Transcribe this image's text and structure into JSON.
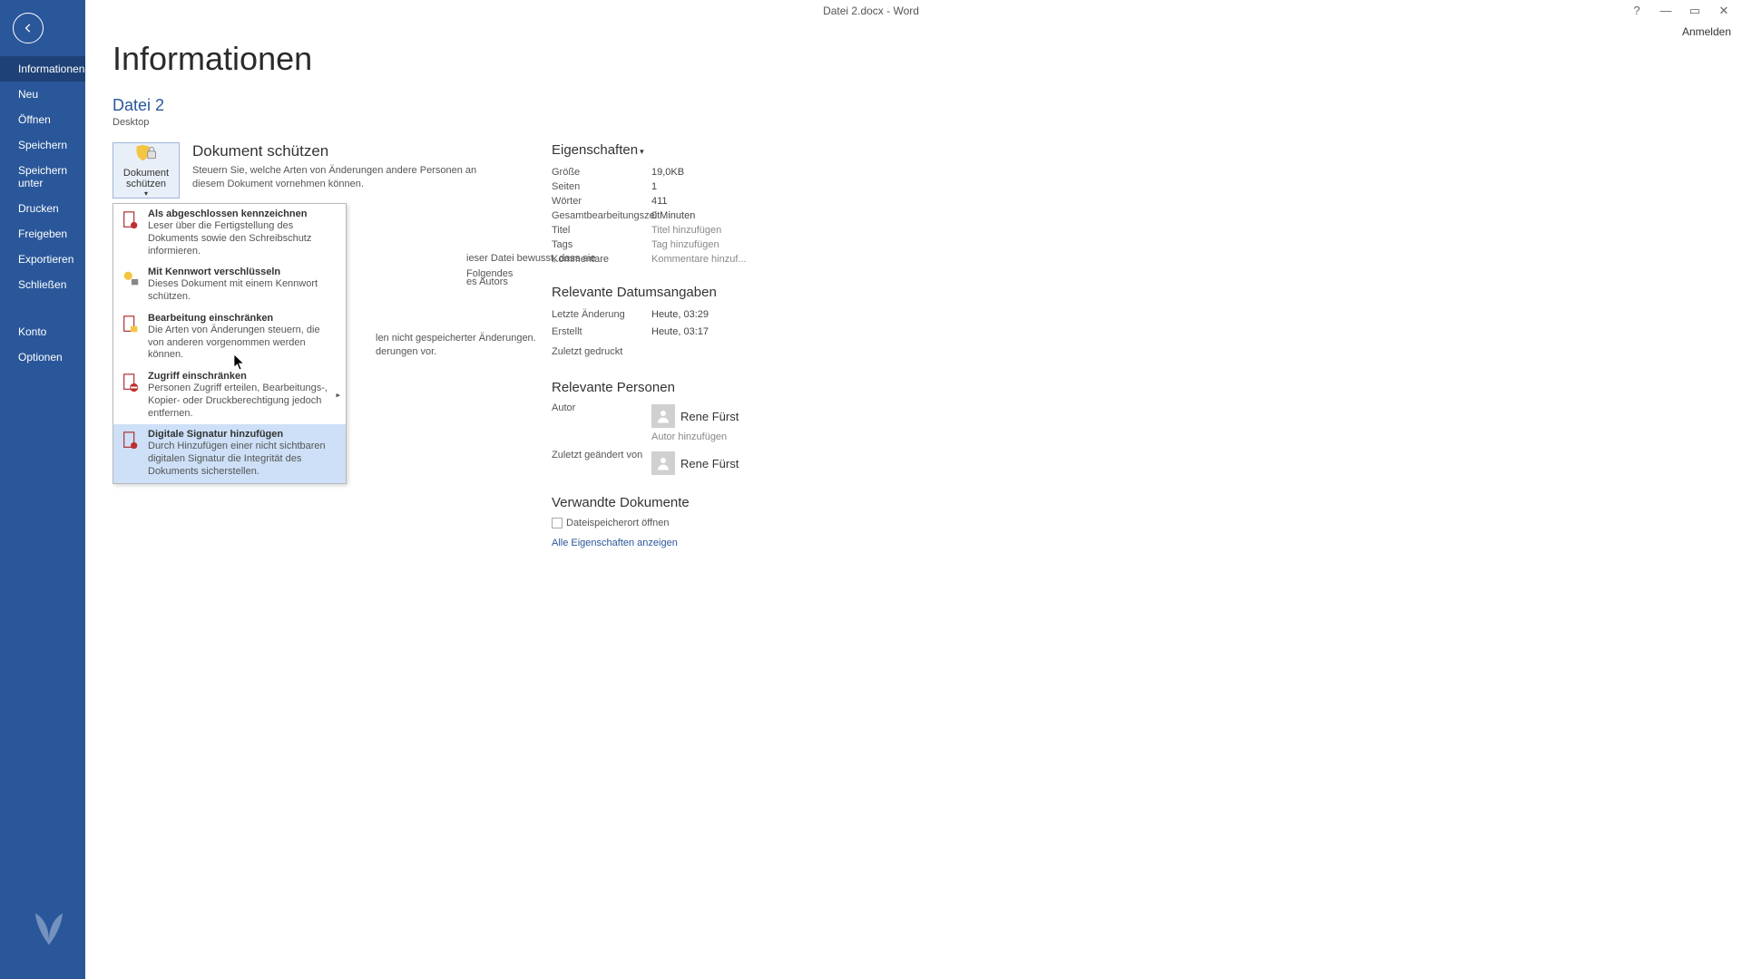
{
  "titlebar": {
    "title": "Datei 2.docx - Word",
    "signin": "Anmelden"
  },
  "sidebar": {
    "items": [
      "Informationen",
      "Neu",
      "Öffnen",
      "Speichern",
      "Speichern unter",
      "Drucken",
      "Freigeben",
      "Exportieren",
      "Schließen"
    ],
    "bottom": [
      "Konto",
      "Optionen"
    ]
  },
  "page": {
    "title": "Informationen",
    "file_name": "Datei 2",
    "file_location": "Desktop"
  },
  "protect": {
    "button_label": "Dokument schützen",
    "section_title": "Dokument schützen",
    "section_desc": "Steuern Sie, welche Arten von Änderungen andere Personen an diesem Dokument vornehmen können."
  },
  "bg_fragments": {
    "a": "ieser Datei bewusst, dass sie Folgendes",
    "b": "es Autors",
    "c": "len nicht gespeicherter Änderungen.",
    "d": "derungen vor."
  },
  "dropdown": [
    {
      "title": "Als abgeschlossen kennzeichnen",
      "desc": "Leser über die Fertigstellung des Dokuments sowie den Schreibschutz informieren."
    },
    {
      "title": "Mit Kennwort verschlüsseln",
      "desc": "Dieses Dokument mit einem Kennwort schützen."
    },
    {
      "title": "Bearbeitung einschränken",
      "desc": "Die Arten von Änderungen steuern, die von anderen vorgenommen werden können."
    },
    {
      "title": "Zugriff einschränken",
      "desc": "Personen Zugriff erteilen, Bearbeitungs-, Kopier- oder Druckberechtigung jedoch entfernen.",
      "submenu": true
    },
    {
      "title": "Digitale Signatur hinzufügen",
      "desc": "Durch Hinzufügen einer nicht sichtbaren digitalen Signatur die Integrität des Dokuments sicherstellen."
    }
  ],
  "properties": {
    "heading": "Eigenschaften",
    "rows": [
      {
        "label": "Größe",
        "value": "19,0KB"
      },
      {
        "label": "Seiten",
        "value": "1"
      },
      {
        "label": "Wörter",
        "value": "411"
      },
      {
        "label": "Gesamtbearbeitungszeit",
        "value": "0 Minuten"
      },
      {
        "label": "Titel",
        "placeholder": "Titel hinzufügen"
      },
      {
        "label": "Tags",
        "placeholder": "Tag hinzufügen"
      },
      {
        "label": "Kommentare",
        "placeholder": "Kommentare hinzuf..."
      }
    ]
  },
  "dates": {
    "heading": "Relevante Datumsangaben",
    "rows": [
      {
        "label": "Letzte Änderung",
        "value": "Heute, 03:29"
      },
      {
        "label": "Erstellt",
        "value": "Heute, 03:17"
      },
      {
        "label": "Zuletzt gedruckt",
        "value": ""
      }
    ]
  },
  "people": {
    "heading": "Relevante Personen",
    "author_label": "Autor",
    "author_name": "Rene Fürst",
    "author_add": "Autor hinzufügen",
    "modified_label": "Zuletzt geändert von",
    "modified_name": "Rene Fürst"
  },
  "related_docs": {
    "heading": "Verwandte Dokumente",
    "open_location": "Dateispeicherort öffnen",
    "show_all": "Alle Eigenschaften anzeigen"
  }
}
